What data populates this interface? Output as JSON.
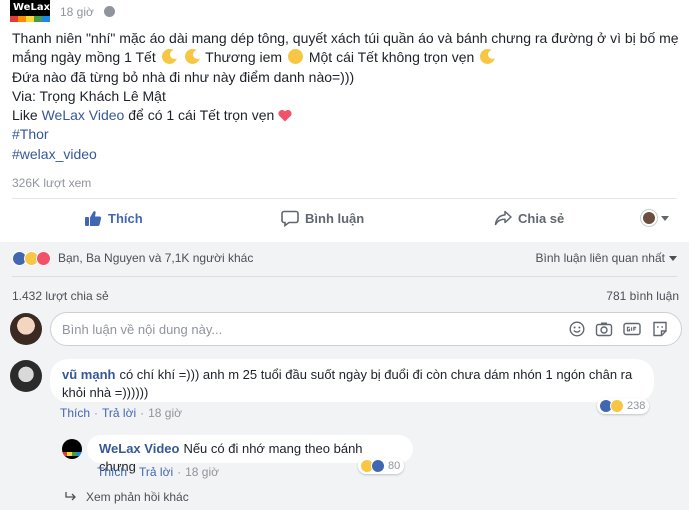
{
  "post": {
    "page_logo": "WeLax",
    "time": "18 giờ",
    "lines": [
      "Thanh niên \"nhí\" mặc áo dài mang dép tông, quyết xách túi quần áo và bánh chưng ra đường ở vì bị bố mẹ",
      "mắng ngày mồng 1 Tết",
      "Thương iem",
      "Một cái Tết không trọn vẹn",
      "Đứa nào đã từng bỏ nhà đi như này điểm danh nào=)))",
      "Via: Trọng Khách Lê Mật",
      "Like",
      "WeLax Video",
      "để có 1 cái Tết trọn vẹn",
      "#Thor",
      "#welax_video"
    ],
    "views": "326K lượt xem"
  },
  "actions": {
    "like": "Thích",
    "comment": "Bình luận",
    "share": "Chia sẻ"
  },
  "reactions": {
    "summary": "Bạn, Ba Nguyen và 7,1K người khác",
    "sort": "Bình luận liên quan nhất",
    "shares": "1.432 lượt chia sẻ",
    "comments": "781 bình luận"
  },
  "composer": {
    "placeholder": "Bình luận về nội dung này..."
  },
  "comments": [
    {
      "author": "vũ mạnh",
      "text_line1": "có chí khí =))) anh m 25 tuổi đầu suốt ngày bị đuổi đi còn chưa dám nhón 1 ngón chân ra",
      "text_line2": "khỏi nhà =))))))",
      "like": "Thích",
      "reply": "Trả lời",
      "time": "18 giờ",
      "reaction_count": "238"
    },
    {
      "author": "WeLax Video",
      "text": "Nếu có đi nhớ mang theo bánh chưng",
      "like": "Thích",
      "reply": "Trả lời",
      "time": "18 giờ",
      "reaction_count": "80"
    }
  ],
  "more_replies": "Xem phản hồi khác",
  "colors": {
    "link": "#365899",
    "like_blue": "#4267b2",
    "grey_bg": "#f2f3f5",
    "heart": "#f25268"
  }
}
